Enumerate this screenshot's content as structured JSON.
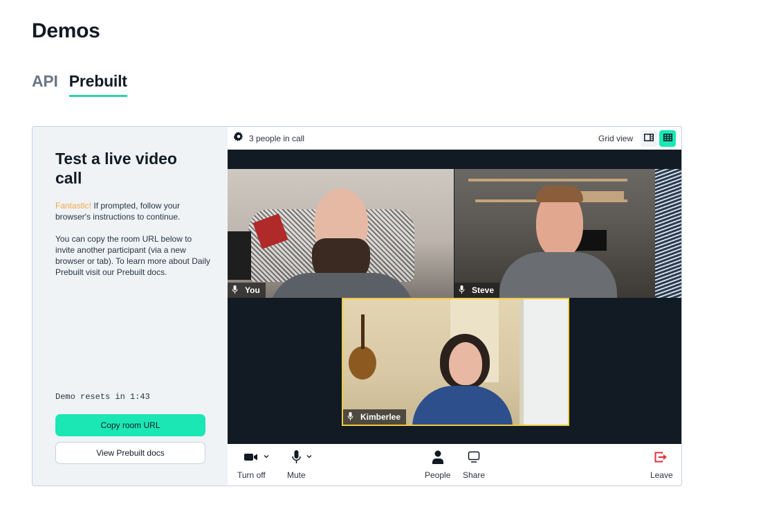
{
  "page": {
    "title": "Demos"
  },
  "tabs": [
    {
      "label": "API",
      "active": false
    },
    {
      "label": "Prebuilt",
      "active": true
    }
  ],
  "sidebar": {
    "title": "Test a live video call",
    "highlight": "Fantastic!",
    "paragraph1_rest": " If prompted, follow your browser's instructions to continue.",
    "paragraph2": "You can copy the room URL below to invite another participant (via a new browser or tab). To learn more about Daily Prebuilt visit our Prebuilt docs.",
    "countdown": "Demo resets in 1:43",
    "copy_button": "Copy room URL",
    "docs_button": "View Prebuilt docs"
  },
  "call": {
    "topbar": {
      "settings_icon": "gear-icon",
      "people_count": "3 people in call",
      "view_label": "Grid view",
      "view_modes": [
        {
          "name": "speaker-view",
          "icon": "speaker-layout-icon",
          "active": false
        },
        {
          "name": "grid-view",
          "icon": "grid-layout-icon",
          "active": true
        }
      ]
    },
    "participants": [
      {
        "name": "You",
        "mic_icon": "microphone-icon",
        "active_speaker": false
      },
      {
        "name": "Steve",
        "mic_icon": "microphone-icon",
        "active_speaker": false
      },
      {
        "name": "Kimberlee",
        "mic_icon": "microphone-icon",
        "active_speaker": true
      }
    ],
    "toolbar": {
      "camera": {
        "label": "Turn off",
        "icon": "video-camera-icon"
      },
      "mic": {
        "label": "Mute",
        "icon": "microphone-icon"
      },
      "people": {
        "label": "People",
        "icon": "person-icon"
      },
      "share": {
        "label": "Share",
        "icon": "monitor-icon"
      },
      "leave": {
        "label": "Leave",
        "icon": "leave-icon"
      }
    }
  },
  "colors": {
    "accent": "#1be7b4",
    "tab_underline": "#2bd4a8",
    "highlight": "#f5a742",
    "active_speaker_border": "#f0cc3f",
    "leave": "#e0333c",
    "call_background": "#121a24"
  }
}
